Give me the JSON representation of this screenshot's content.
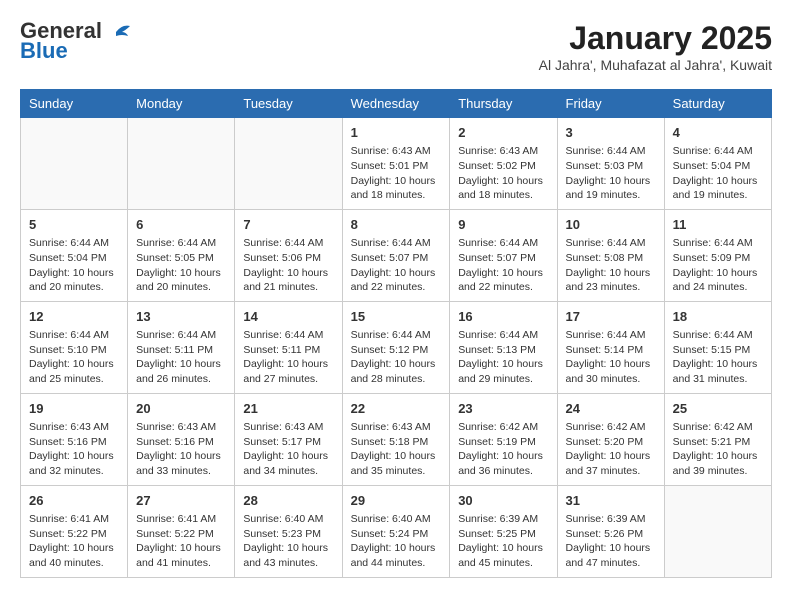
{
  "header": {
    "logo_general": "General",
    "logo_blue": "Blue",
    "title": "January 2025",
    "subtitle": "Al Jahra', Muhafazat al Jahra', Kuwait"
  },
  "days_of_week": [
    "Sunday",
    "Monday",
    "Tuesday",
    "Wednesday",
    "Thursday",
    "Friday",
    "Saturday"
  ],
  "weeks": [
    [
      {
        "day": "",
        "info": ""
      },
      {
        "day": "",
        "info": ""
      },
      {
        "day": "",
        "info": ""
      },
      {
        "day": "1",
        "info": "Sunrise: 6:43 AM\nSunset: 5:01 PM\nDaylight: 10 hours and 18 minutes."
      },
      {
        "day": "2",
        "info": "Sunrise: 6:43 AM\nSunset: 5:02 PM\nDaylight: 10 hours and 18 minutes."
      },
      {
        "day": "3",
        "info": "Sunrise: 6:44 AM\nSunset: 5:03 PM\nDaylight: 10 hours and 19 minutes."
      },
      {
        "day": "4",
        "info": "Sunrise: 6:44 AM\nSunset: 5:04 PM\nDaylight: 10 hours and 19 minutes."
      }
    ],
    [
      {
        "day": "5",
        "info": "Sunrise: 6:44 AM\nSunset: 5:04 PM\nDaylight: 10 hours and 20 minutes."
      },
      {
        "day": "6",
        "info": "Sunrise: 6:44 AM\nSunset: 5:05 PM\nDaylight: 10 hours and 20 minutes."
      },
      {
        "day": "7",
        "info": "Sunrise: 6:44 AM\nSunset: 5:06 PM\nDaylight: 10 hours and 21 minutes."
      },
      {
        "day": "8",
        "info": "Sunrise: 6:44 AM\nSunset: 5:07 PM\nDaylight: 10 hours and 22 minutes."
      },
      {
        "day": "9",
        "info": "Sunrise: 6:44 AM\nSunset: 5:07 PM\nDaylight: 10 hours and 22 minutes."
      },
      {
        "day": "10",
        "info": "Sunrise: 6:44 AM\nSunset: 5:08 PM\nDaylight: 10 hours and 23 minutes."
      },
      {
        "day": "11",
        "info": "Sunrise: 6:44 AM\nSunset: 5:09 PM\nDaylight: 10 hours and 24 minutes."
      }
    ],
    [
      {
        "day": "12",
        "info": "Sunrise: 6:44 AM\nSunset: 5:10 PM\nDaylight: 10 hours and 25 minutes."
      },
      {
        "day": "13",
        "info": "Sunrise: 6:44 AM\nSunset: 5:11 PM\nDaylight: 10 hours and 26 minutes."
      },
      {
        "day": "14",
        "info": "Sunrise: 6:44 AM\nSunset: 5:11 PM\nDaylight: 10 hours and 27 minutes."
      },
      {
        "day": "15",
        "info": "Sunrise: 6:44 AM\nSunset: 5:12 PM\nDaylight: 10 hours and 28 minutes."
      },
      {
        "day": "16",
        "info": "Sunrise: 6:44 AM\nSunset: 5:13 PM\nDaylight: 10 hours and 29 minutes."
      },
      {
        "day": "17",
        "info": "Sunrise: 6:44 AM\nSunset: 5:14 PM\nDaylight: 10 hours and 30 minutes."
      },
      {
        "day": "18",
        "info": "Sunrise: 6:44 AM\nSunset: 5:15 PM\nDaylight: 10 hours and 31 minutes."
      }
    ],
    [
      {
        "day": "19",
        "info": "Sunrise: 6:43 AM\nSunset: 5:16 PM\nDaylight: 10 hours and 32 minutes."
      },
      {
        "day": "20",
        "info": "Sunrise: 6:43 AM\nSunset: 5:16 PM\nDaylight: 10 hours and 33 minutes."
      },
      {
        "day": "21",
        "info": "Sunrise: 6:43 AM\nSunset: 5:17 PM\nDaylight: 10 hours and 34 minutes."
      },
      {
        "day": "22",
        "info": "Sunrise: 6:43 AM\nSunset: 5:18 PM\nDaylight: 10 hours and 35 minutes."
      },
      {
        "day": "23",
        "info": "Sunrise: 6:42 AM\nSunset: 5:19 PM\nDaylight: 10 hours and 36 minutes."
      },
      {
        "day": "24",
        "info": "Sunrise: 6:42 AM\nSunset: 5:20 PM\nDaylight: 10 hours and 37 minutes."
      },
      {
        "day": "25",
        "info": "Sunrise: 6:42 AM\nSunset: 5:21 PM\nDaylight: 10 hours and 39 minutes."
      }
    ],
    [
      {
        "day": "26",
        "info": "Sunrise: 6:41 AM\nSunset: 5:22 PM\nDaylight: 10 hours and 40 minutes."
      },
      {
        "day": "27",
        "info": "Sunrise: 6:41 AM\nSunset: 5:22 PM\nDaylight: 10 hours and 41 minutes."
      },
      {
        "day": "28",
        "info": "Sunrise: 6:40 AM\nSunset: 5:23 PM\nDaylight: 10 hours and 43 minutes."
      },
      {
        "day": "29",
        "info": "Sunrise: 6:40 AM\nSunset: 5:24 PM\nDaylight: 10 hours and 44 minutes."
      },
      {
        "day": "30",
        "info": "Sunrise: 6:39 AM\nSunset: 5:25 PM\nDaylight: 10 hours and 45 minutes."
      },
      {
        "day": "31",
        "info": "Sunrise: 6:39 AM\nSunset: 5:26 PM\nDaylight: 10 hours and 47 minutes."
      },
      {
        "day": "",
        "info": ""
      }
    ]
  ]
}
